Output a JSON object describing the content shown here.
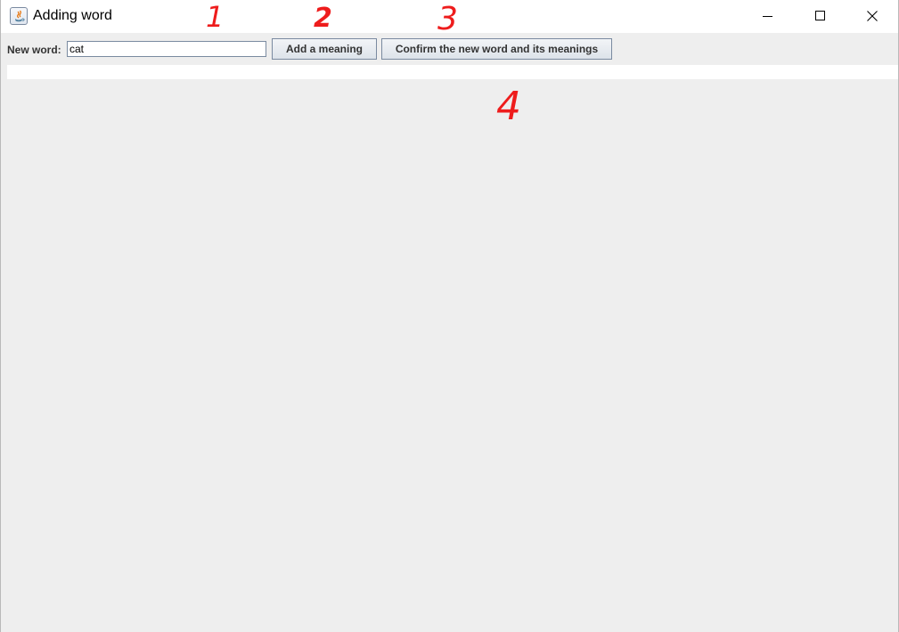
{
  "window": {
    "title": "Adding word",
    "controls": {
      "minimize_icon": "minimize-icon",
      "maximize_icon": "maximize-icon",
      "close_icon": "close-icon"
    }
  },
  "toolbar": {
    "new_word_label": "New word:",
    "new_word_value": "cat",
    "add_meaning_label": "Add a meaning",
    "confirm_label": "Confirm the new word and its meanings"
  },
  "annotations": {
    "one": "1",
    "two": "2",
    "three": "3",
    "four": "4"
  },
  "colors": {
    "annotation": "#ee1c1c",
    "panel_background": "#eeeeee",
    "title_background": "#ffffff"
  }
}
